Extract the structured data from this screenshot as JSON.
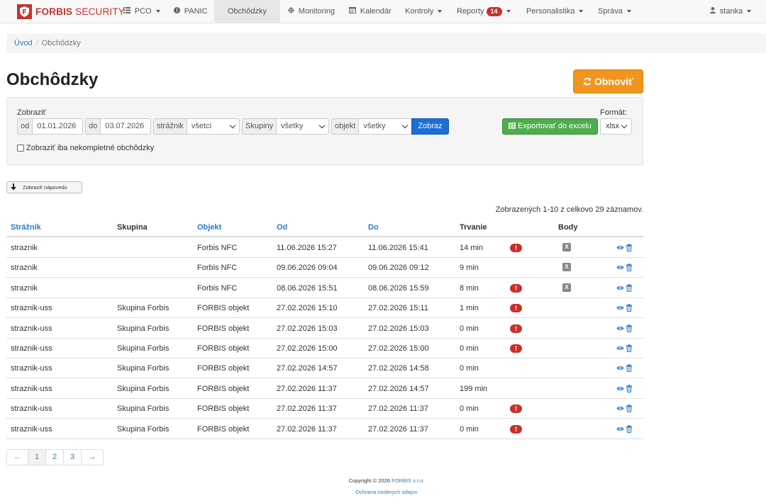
{
  "brand": {
    "name_bold": "FORBIS",
    "name_rest": " SECURITY"
  },
  "nav": {
    "pco": "PCO",
    "panic": "PANIC",
    "obchodzky": "Obchôdzky",
    "monitoring": "Monitoring",
    "kalendar": "Kalendár",
    "kontroly": "Kontroly",
    "reporty": "Reporty",
    "reporty_badge": "14",
    "personalistika": "Personalistika",
    "sprava": "Správa",
    "user": "stanka"
  },
  "breadcrumb": {
    "home": "Úvod",
    "separator": "/",
    "current": "Obchôdzky"
  },
  "page": {
    "title": "Obchôdzky",
    "refresh": "Obnoviť"
  },
  "filter": {
    "show_label": "Zobraziť",
    "from_label": "od",
    "from_value": "01.01.2026",
    "to_label": "do",
    "to_value": "03.07.2026",
    "guard_label": "strážnik",
    "guard_value": "všetci",
    "groups_label": "Skupiny",
    "groups_value": "všetky",
    "object_label": "objekt",
    "object_value": "všetky",
    "submit": "Zobraz",
    "export": "Exportovať do excelu",
    "format_label": "Formát:",
    "format_value": "xlsx",
    "incomplete_label": "Zobraziť iba nekompletné obchôdzky"
  },
  "help_button": "Zobraziť nápovedu",
  "records_info": "Zobrazených 1-10 z celkovo 29 záznamov.",
  "table": {
    "headers": {
      "guard": "Strážnik",
      "group": "Skupina",
      "object": "Objekt",
      "from": "Od",
      "to": "Do",
      "duration": "Trvanie",
      "points": "Body"
    },
    "rows": [
      {
        "guard": "straznik",
        "group": "",
        "object": "Forbis NFC",
        "from": "11.06.2026 15:27",
        "to": "11.06.2026 15:41",
        "duration": "14 min",
        "warn": "!",
        "points": "X"
      },
      {
        "guard": "straznik",
        "group": "",
        "object": "Forbis NFC",
        "from": "09.06.2026 09:04",
        "to": "09.06.2026 09:12",
        "duration": "9 min",
        "warn": "",
        "points": "X"
      },
      {
        "guard": "straznik",
        "group": "",
        "object": "Forbis NFC",
        "from": "08.06.2026 15:51",
        "to": "08.06.2026 15:59",
        "duration": "8 min",
        "warn": "!",
        "points": "X"
      },
      {
        "guard": "straznik-uss",
        "group": "Skupina Forbis",
        "object": "FORBIS objekt",
        "from": "27.02.2026 15:10",
        "to": "27.02.2026 15:11",
        "duration": "1 min",
        "warn": "!",
        "points": ""
      },
      {
        "guard": "straznik-uss",
        "group": "Skupina Forbis",
        "object": "FORBIS objekt",
        "from": "27.02.2026 15:03",
        "to": "27.02.2026 15:03",
        "duration": "0 min",
        "warn": "!",
        "points": ""
      },
      {
        "guard": "straznik-uss",
        "group": "Skupina Forbis",
        "object": "FORBIS objekt",
        "from": "27.02.2026 15:00",
        "to": "27.02.2026 15:00",
        "duration": "0 min",
        "warn": "!",
        "points": ""
      },
      {
        "guard": "straznik-uss",
        "group": "Skupina Forbis",
        "object": "FORBIS objekt",
        "from": "27.02.2026 14:57",
        "to": "27.02.2026 14:58",
        "duration": "0 min",
        "warn": "",
        "points": ""
      },
      {
        "guard": "straznik-uss",
        "group": "Skupina Forbis",
        "object": "FORBIS objekt",
        "from": "27.02.2026 11:37",
        "to": "27.02.2026 14:57",
        "duration": "199 min",
        "warn": "",
        "points": ""
      },
      {
        "guard": "straznik-uss",
        "group": "Skupina Forbis",
        "object": "FORBIS objekt",
        "from": "27.02.2026 11:37",
        "to": "27.02.2026 11:37",
        "duration": "0 min",
        "warn": "!",
        "points": ""
      },
      {
        "guard": "straznik-uss",
        "group": "Skupina Forbis",
        "object": "FORBIS objekt",
        "from": "27.02.2026 11:37",
        "to": "27.02.2026 11:37",
        "duration": "0 min",
        "warn": "!",
        "points": ""
      }
    ]
  },
  "pagination": {
    "prev": "←",
    "pages": [
      "1",
      "2",
      "3"
    ],
    "current_page": "1",
    "next": "→"
  },
  "footer": {
    "copyright": "Copyright © 2026 ",
    "company": "FORBIS s.r.o.",
    "privacy": "Ochrana osobných údajov"
  },
  "colors": {
    "brand_red": "#c9302c",
    "refresh_orange": "#f0961e",
    "submit_blue": "#1a6fd6",
    "export_green": "#4cae4c",
    "link_blue": "#2a7ac9"
  },
  "icons": {
    "pco": "list-icon",
    "panic": "alert-circle-icon",
    "monitoring": "crosshair-icon",
    "kalendar": "calendar-icon",
    "user": "user-icon",
    "refresh": "refresh-icon",
    "export": "table-icon",
    "help": "arrow-down-icon",
    "row_warn": "exclamation-icon",
    "row_points": "x-icon",
    "row_view": "eye-icon",
    "row_delete": "trash-icon"
  }
}
